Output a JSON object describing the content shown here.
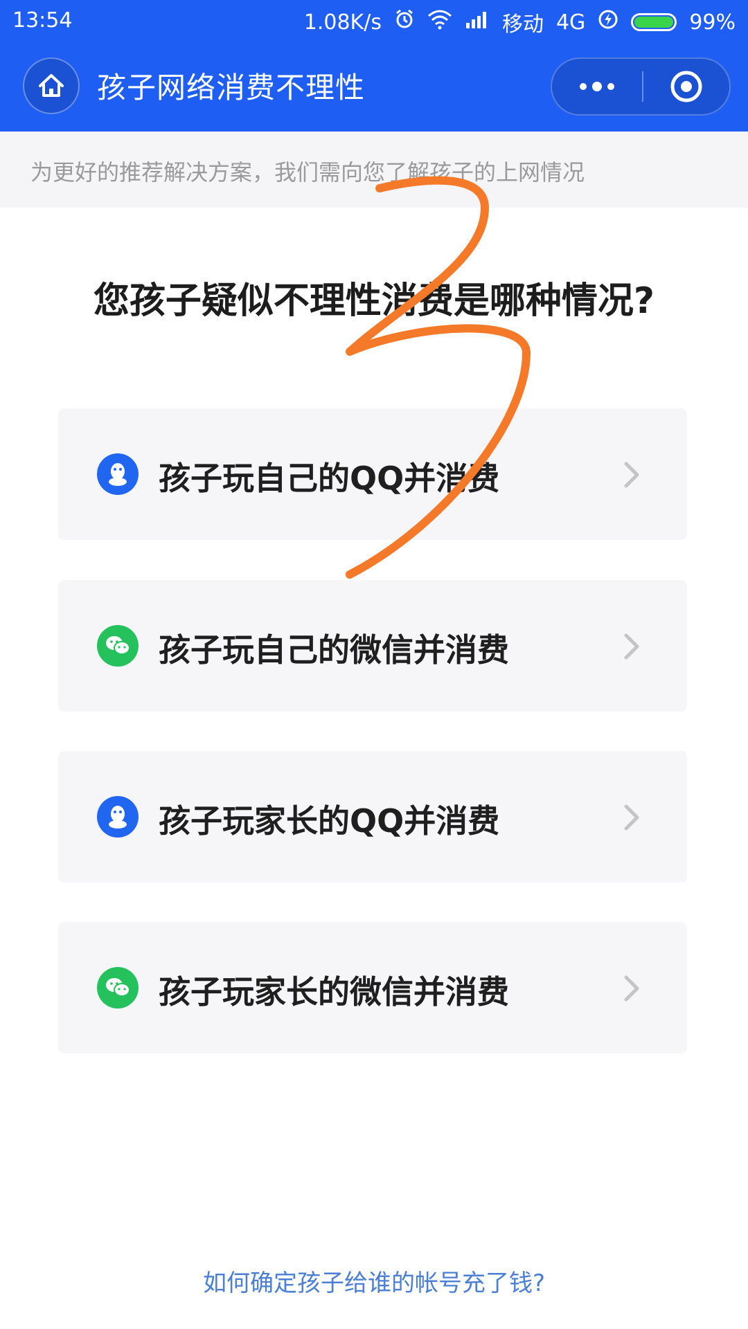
{
  "status_bar": {
    "time": "13:54",
    "net_speed": "1.08K/s",
    "carrier": "移动",
    "network": "4G",
    "battery": "99%",
    "icons": [
      "alarm-icon",
      "wifi-icon",
      "signal-icon",
      "charging-icon",
      "battery-icon"
    ]
  },
  "nav": {
    "title": "孩子网络消费不理性",
    "home_icon": "home-icon",
    "more_icon": "more-dots-icon",
    "close_icon": "close-circle-icon"
  },
  "banner": {
    "text": "为更好的推荐解决方案，我们需向您了解孩子的上网情况"
  },
  "question": "您孩子疑似不理性消费是哪种情况?",
  "options": [
    {
      "label": "孩子玩自己的QQ并消费",
      "icon": "qq-icon"
    },
    {
      "label": "孩子玩自己的微信并消费",
      "icon": "wechat-icon"
    },
    {
      "label": "孩子玩家长的QQ并消费",
      "icon": "qq-icon"
    },
    {
      "label": "孩子玩家长的微信并消费",
      "icon": "wechat-icon"
    }
  ],
  "footer_link": "如何确定孩子给谁的帐号充了钱?",
  "colors": {
    "header": "#1f5ef2",
    "qq": "#2166f0",
    "wechat": "#25c15c",
    "link": "#4a7fd3",
    "annotation": "#f47a2a"
  }
}
